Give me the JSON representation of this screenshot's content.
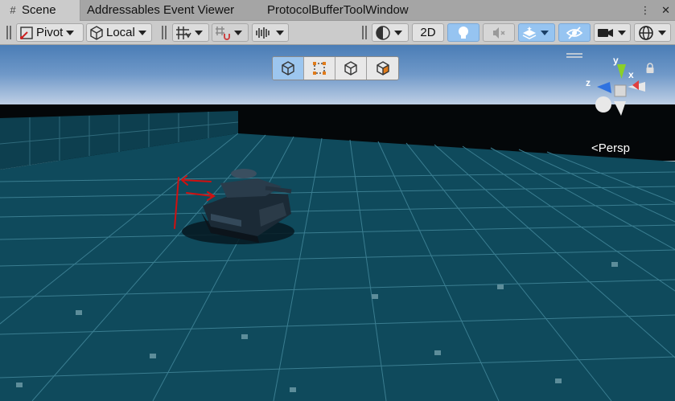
{
  "tabs": [
    {
      "label": "Scene",
      "icon": "grid-icon",
      "active": true
    },
    {
      "label": "Addressables Event Viewer",
      "active": false
    },
    {
      "label": "ProtocolBufferToolWindow",
      "active": false
    }
  ],
  "window_icons": {
    "menu": "⋮",
    "close": "✕"
  },
  "toolbar": {
    "pivot_label": "Pivot",
    "local_label": "Local",
    "mode_2d_label": "2D"
  },
  "scene_view": {
    "projection_label": "Persp",
    "gizmo_axes": {
      "x": "x",
      "y": "y",
      "z": "z"
    }
  },
  "colors": {
    "floor": "#0f4a5c",
    "wall": "#0d3f4f",
    "sky_top": "#4f80b8",
    "sky_horizon": "#c9d6e8",
    "toolbar_bg": "#cbcbcb",
    "accent_blue": "#96c4f1",
    "annotation_red": "#d01010"
  }
}
